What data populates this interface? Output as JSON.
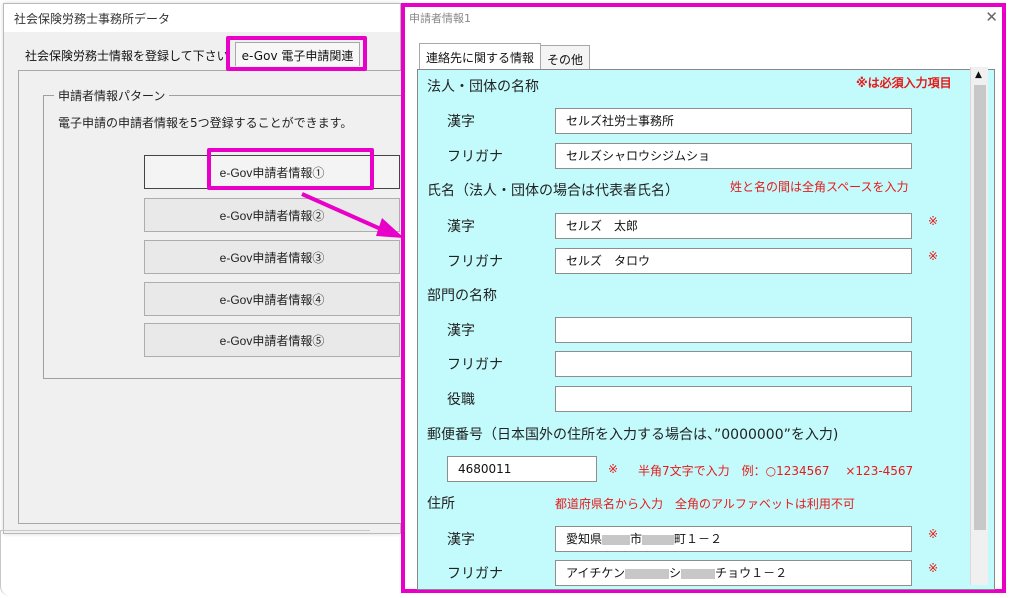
{
  "back_window": {
    "title": "社会保険労務士事務所データ",
    "tabs": [
      "社会保険労務士情報を登録して下さい",
      "e-Gov 電子申請関連"
    ],
    "group_label": "申請者情報パターン",
    "description": "電子申請の申請者情報を5つ登録することができます。",
    "buttons": [
      "e-Gov申請者情報①",
      "e-Gov申請者情報②",
      "e-Gov申請者情報③",
      "e-Gov申請者情報④",
      "e-Gov申請者情報⑤"
    ]
  },
  "front_window": {
    "title": "申請者情報1",
    "tabs": [
      "連絡先に関する情報",
      "その他"
    ],
    "required_note": "※は必須入力項目",
    "section_corp": "法人・団体の名称",
    "section_name": "氏名（法人・団体の場合は代表者氏名）",
    "name_note": "姓と名の間は全角スペースを入力",
    "section_dept": "部門の名称",
    "section_postal": "郵便番号（日本国外の住所を入力する場合は、”0000000”を入力)",
    "postal_note": "半角7文字で入力　例：○1234567　 ×123-4567",
    "section_address": "住所",
    "address_note": "都道府県名から入力　全角のアルファベットは利用不可",
    "label_kanji": "漢字",
    "label_furigana": "フリガナ",
    "label_title": "役職",
    "required_mark": "※",
    "values": {
      "corp_kanji": "セルズ社労士事務所",
      "corp_kana": "セルズシャロウシジムショ",
      "name_kanji": "セルズ　太郎",
      "name_kana": "セルズ　タロウ",
      "dept_kanji": "",
      "dept_kana": "",
      "dept_title": "",
      "postal": "4680011",
      "addr_kanji_pre": "愛知県",
      "addr_kanji_mid": "市",
      "addr_kanji_post": "町１－２",
      "addr_kana_pre": "アイチケン",
      "addr_kana_mid": "シ",
      "addr_kana_post": "チョウ１－２"
    }
  },
  "colors": {
    "highlight": "#e800c9",
    "form_background": "#c3fbfc",
    "required_red": "#e81919"
  }
}
